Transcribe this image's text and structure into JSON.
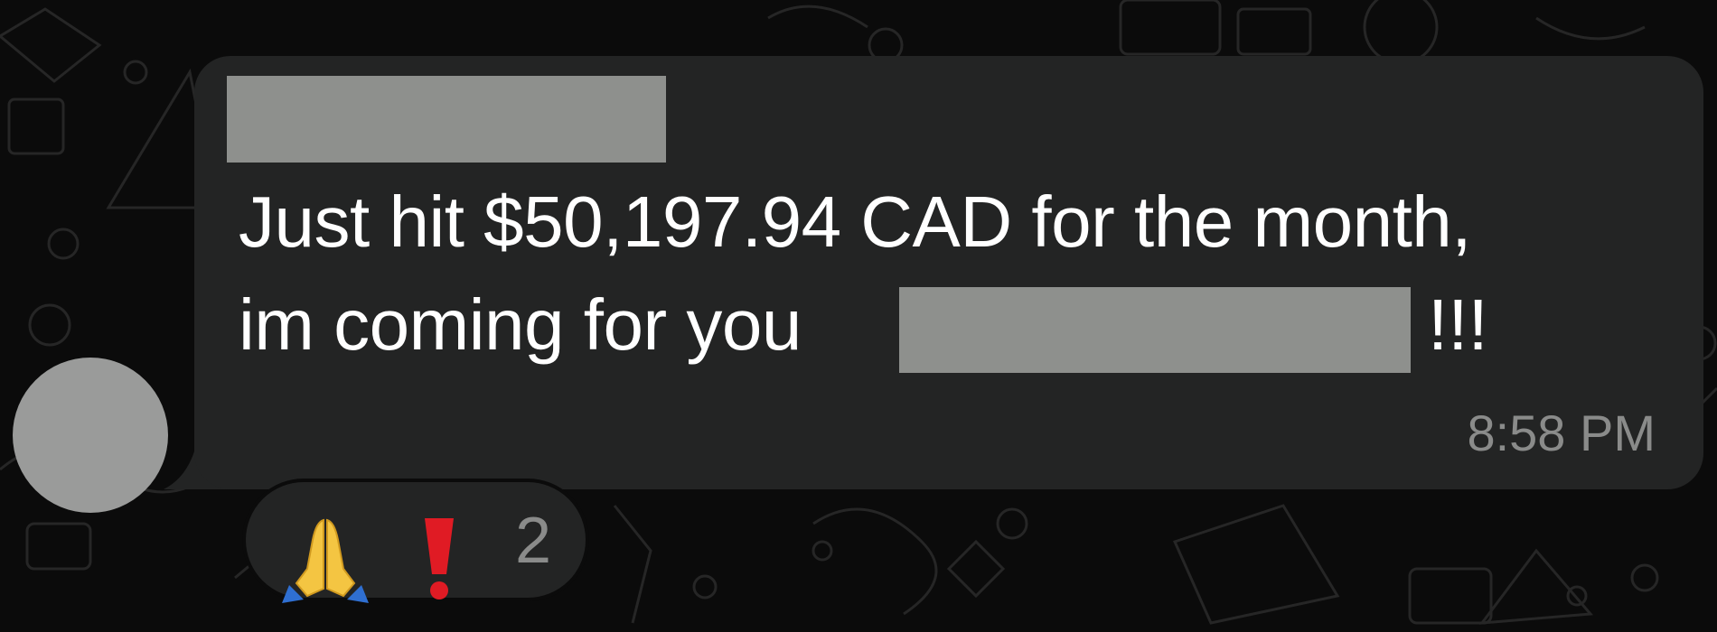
{
  "message": {
    "sender_name": "",
    "line1": "Just hit $50,197.94 CAD for the month,",
    "line2": "im coming for you",
    "mention": "",
    "emphasis": "!!!",
    "time": "8:58 PM"
  },
  "reactions": {
    "emojis": [
      "folded-hands-icon",
      "exclamation-icon"
    ],
    "count": "2"
  },
  "colors": {
    "background": "#0b0b0b",
    "bubble": "#232424",
    "text": "#ffffff",
    "muted": "#8a8b8a",
    "redaction": "#8e908d",
    "exclaim_red": "#e01b24",
    "hands_yellow": "#f4c542",
    "sleeve_blue": "#2f6fd1"
  }
}
